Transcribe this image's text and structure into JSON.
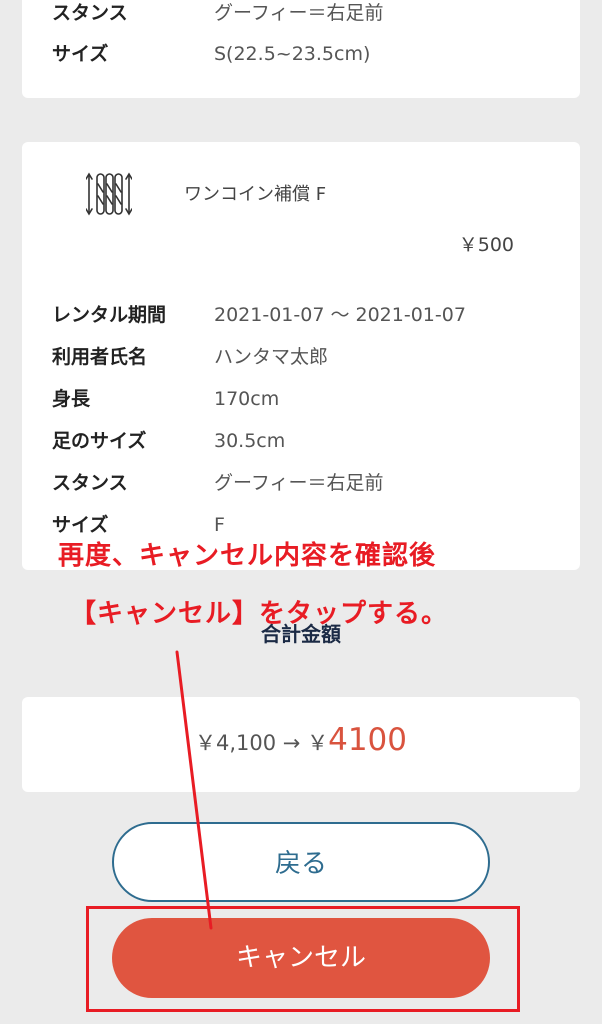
{
  "top_card": {
    "rows": [
      {
        "key": "スタンス",
        "value": "グーフィー＝右足前"
      },
      {
        "key": "サイズ",
        "value": "S(22.5~23.5cm)"
      }
    ]
  },
  "item_card": {
    "icon": "wax-board-icon",
    "name": "ワンコイン補償 F",
    "price": "￥500",
    "rows": [
      {
        "key": "レンタル期間",
        "value": "2021-01-07 〜 2021-01-07"
      },
      {
        "key": "利用者氏名",
        "value": "ハンタマ太郎"
      },
      {
        "key": "身長",
        "value": "170cm"
      },
      {
        "key": "足のサイズ",
        "value": "30.5cm"
      },
      {
        "key": "スタンス",
        "value": "グーフィー＝右足前"
      },
      {
        "key": "サイズ",
        "value": "F"
      }
    ]
  },
  "total": {
    "label": "合計金額",
    "old": "￥4,100",
    "arrow": "→",
    "currency": "￥",
    "new": "4100"
  },
  "annotation": {
    "line1": "再度、キャンセル内容を確認後",
    "line2": "【キャンセル】をタップする。",
    "color": "#e81c24"
  },
  "buttons": {
    "back": "戻る",
    "cancel": "キャンセル"
  },
  "colors": {
    "accent": "#e05540",
    "back_border": "#2e6c8f",
    "total_label": "#1b2a45"
  }
}
